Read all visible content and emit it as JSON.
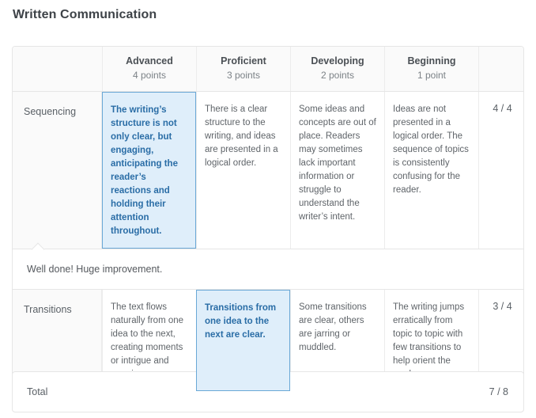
{
  "page_title": "Written Communication",
  "rubric": {
    "columns": [
      {
        "title": "",
        "points": ""
      },
      {
        "title": "Advanced",
        "points": "4 points"
      },
      {
        "title": "Proficient",
        "points": "3 points"
      },
      {
        "title": "Developing",
        "points": "2 points"
      },
      {
        "title": "Beginning",
        "points": "1 point"
      },
      {
        "title": "",
        "points": ""
      }
    ],
    "criteria": [
      {
        "name": "Sequencing",
        "ratings": [
          {
            "text": "The writing’s structure is not only clear, but engaging, anticipating the reader’s reactions and holding their attention throughout.",
            "selected": true
          },
          {
            "text": "There is a clear structure to the writing, and ideas are presented in a logical order.",
            "selected": false
          },
          {
            "text": "Some ideas and concepts are out of place. Readers may sometimes lack important information or struggle to understand the writer’s intent.",
            "selected": false
          },
          {
            "text": "Ideas are not presented in a logical order. The sequence of topics is consistently confusing for the reader.",
            "selected": false
          }
        ],
        "score": "4 / 4",
        "comment": "Well done! Huge improvement."
      },
      {
        "name": "Transitions",
        "ratings": [
          {
            "text": "The text flows naturally from one idea to the next, creating moments or intrigue and surprise.",
            "selected": false
          },
          {
            "text": "Transitions from one idea to the next are clear.",
            "selected": true
          },
          {
            "text": "Some transitions are clear, others are jarring or muddled.",
            "selected": false
          },
          {
            "text": "The writing jumps erratically from topic to topic with few transitions to help orient the reader",
            "selected": false
          }
        ],
        "score": "3 / 4",
        "comment": null
      }
    ]
  },
  "total": {
    "label": "Total",
    "value": "7 / 8"
  },
  "colors": {
    "selected_border": "#6aa8d6",
    "selected_background": "#dfeefa",
    "selected_text": "#2a6da6",
    "card_border": "#e6e6e6",
    "header_background": "#fafafa"
  }
}
